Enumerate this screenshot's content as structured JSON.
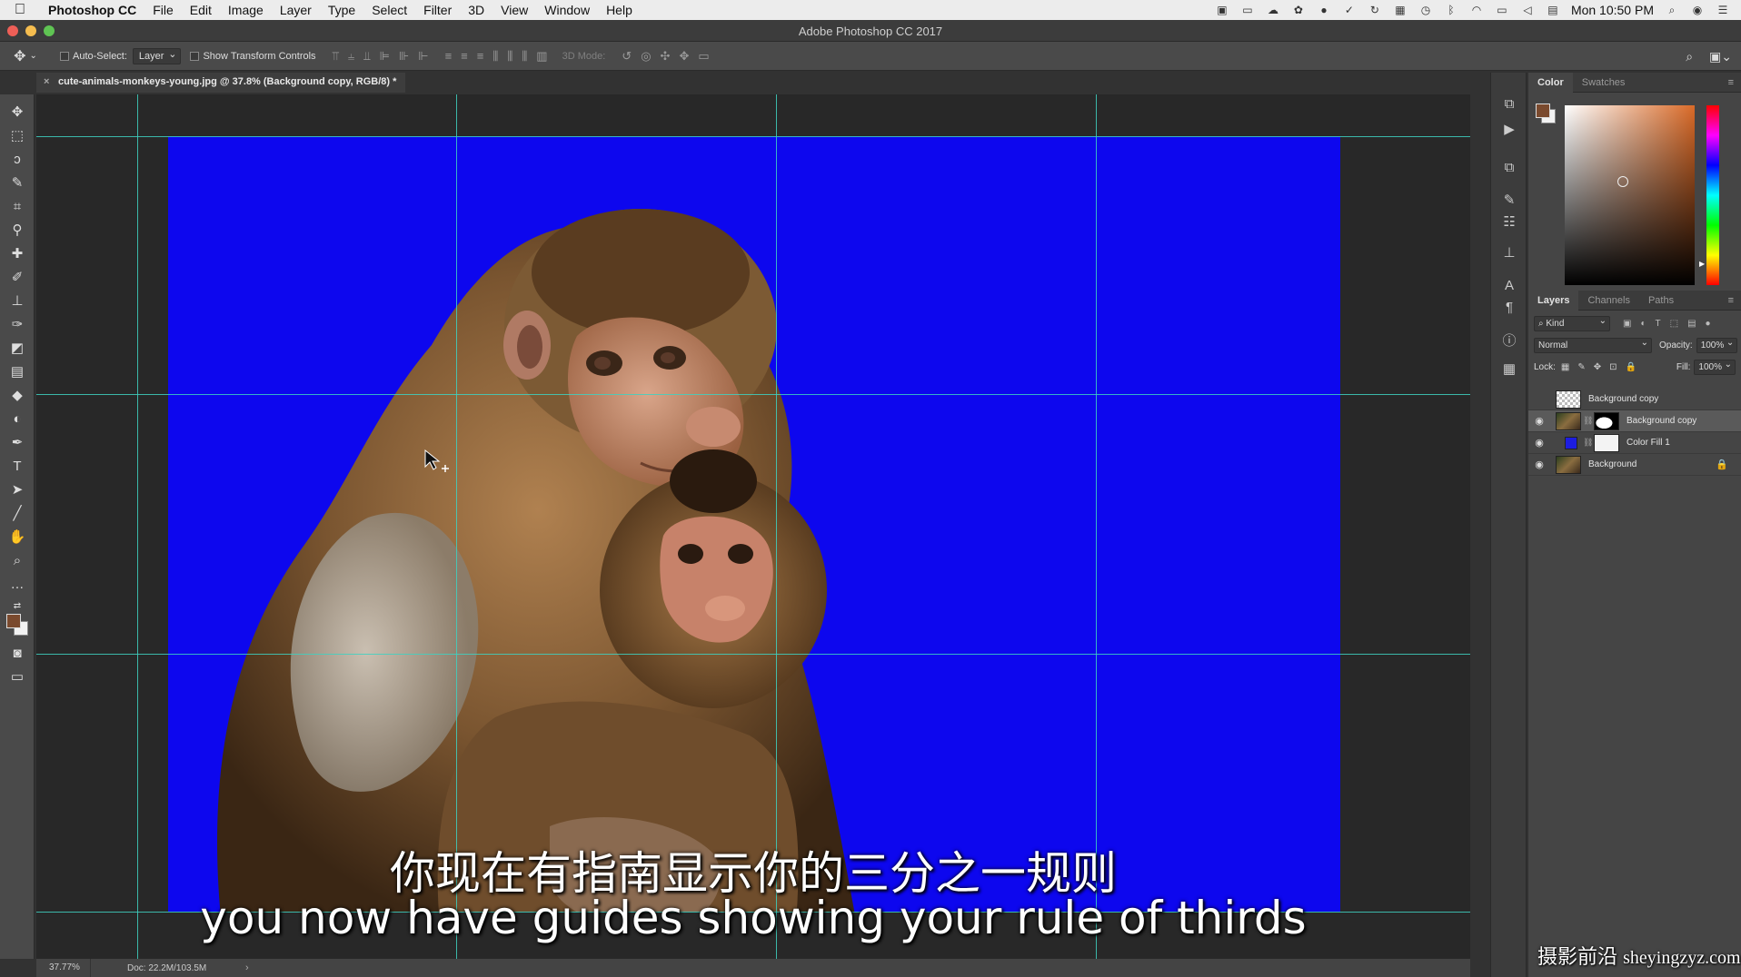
{
  "menubar": {
    "apple": "",
    "app_name": "Photoshop CC",
    "menus": [
      "File",
      "Edit",
      "Image",
      "Layer",
      "Type",
      "Select",
      "Filter",
      "3D",
      "View",
      "Window",
      "Help"
    ],
    "clock": "Mon 10:50 PM"
  },
  "window": {
    "title": "Adobe Photoshop CC 2017",
    "traffic_colors": [
      "#ee5f57",
      "#f5bd4f",
      "#5fc453"
    ]
  },
  "options_bar": {
    "auto_select_label": "Auto-Select:",
    "auto_select_target": "Layer",
    "show_transform_label": "Show Transform Controls",
    "mode_3d_label": "3D Mode:"
  },
  "document": {
    "tab_label": "cute-animals-monkeys-young.jpg @ 37.8% (Background copy, RGB/8) *",
    "close_glyph": "×",
    "background_color": "#0d07ee",
    "guide_color": "#3ed1c1"
  },
  "statusbar": {
    "zoom": "37.77%",
    "doc_info": "Doc: 22.2M/103.5M",
    "arrow": "›"
  },
  "color_panel": {
    "tabs": [
      "Color",
      "Swatches"
    ],
    "foreground": "#7a4a2e",
    "background": "#f2f2f2"
  },
  "layers_panel": {
    "tabs": [
      "Layers",
      "Channels",
      "Paths"
    ],
    "filter_kind": "Kind",
    "blend_mode": "Normal",
    "opacity_label": "Opacity:",
    "opacity_value": "100%",
    "lock_label": "Lock:",
    "fill_label": "Fill:",
    "fill_value": "100%",
    "layers": [
      {
        "name": "Background copy",
        "visible": false,
        "selected": false
      },
      {
        "name": "Background copy",
        "visible": true,
        "selected": true
      },
      {
        "name": "Color Fill 1",
        "visible": true,
        "selected": false
      },
      {
        "name": "Background",
        "visible": true,
        "selected": false
      }
    ]
  },
  "subtitle": {
    "chinese": "你现在有指南显示你的三分之一规则",
    "english": "you now have guides showing your rule of thirds"
  },
  "watermark": {
    "brand": "摄影前沿",
    "url": "sheyingzyz.com"
  }
}
